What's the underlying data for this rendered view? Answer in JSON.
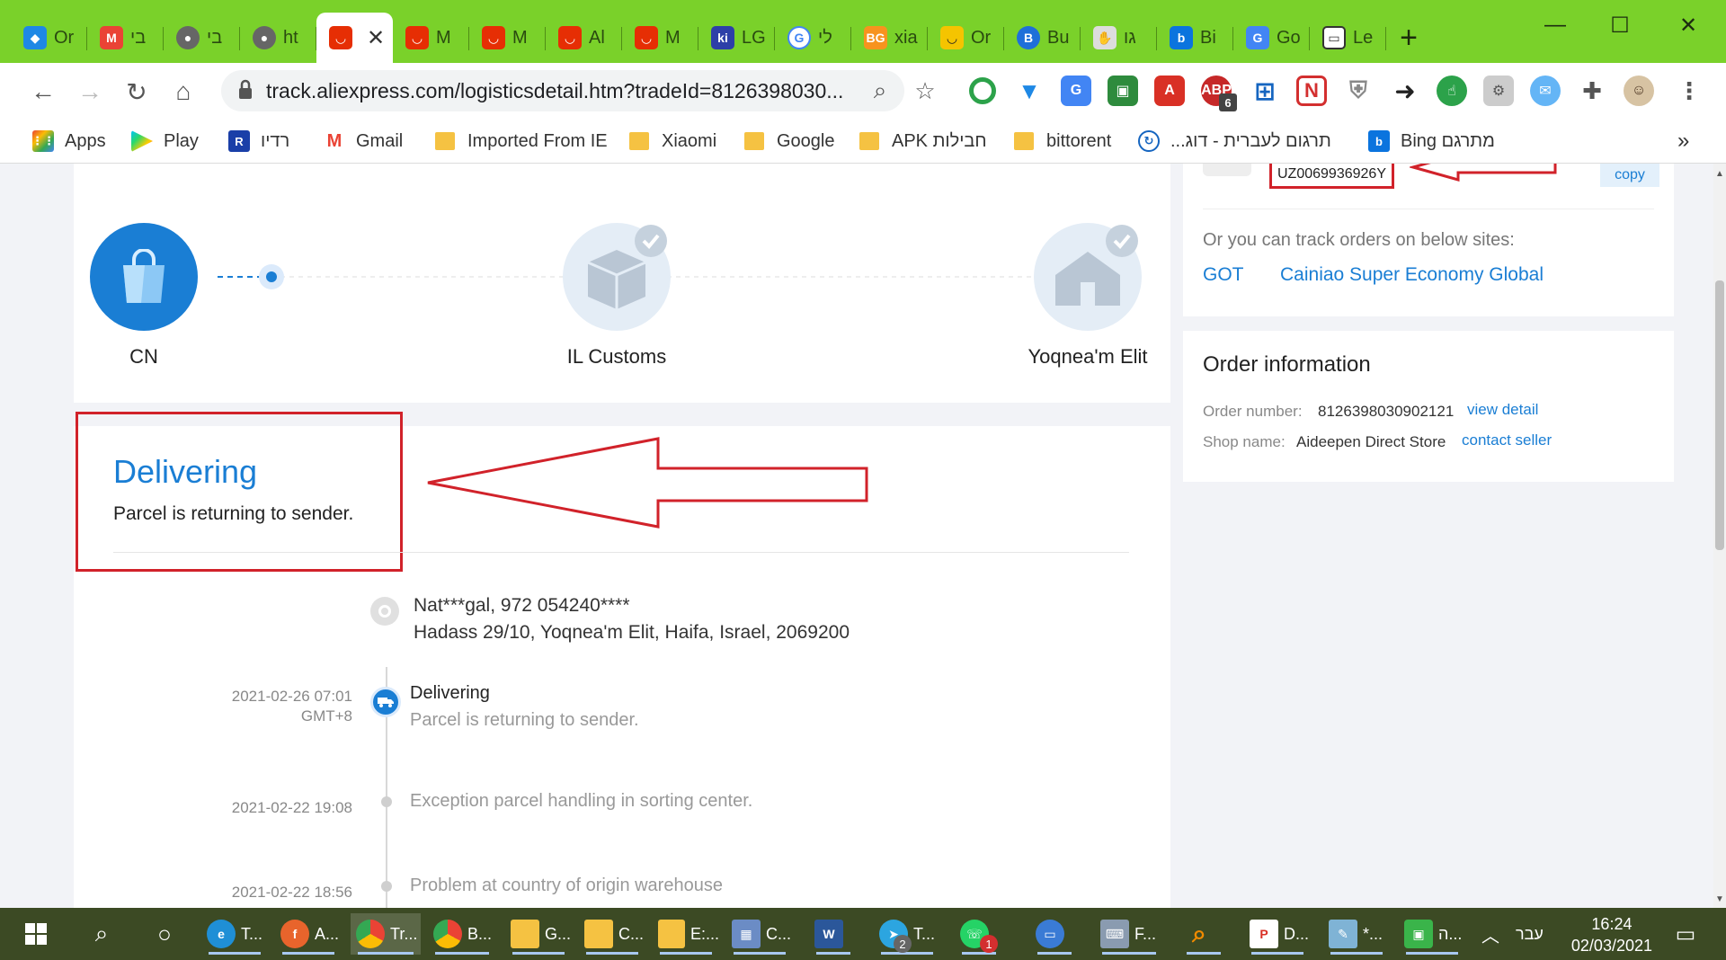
{
  "browser": {
    "tabs": [
      {
        "label": "Or",
        "icon": "diamond-icon",
        "color": "#1e88e5"
      },
      {
        "label": "בי",
        "icon": "gmail-icon",
        "color": "#ea4335"
      },
      {
        "label": "בי",
        "icon": "globe-icon",
        "color": "#666666"
      },
      {
        "label": "ht",
        "icon": "globe-icon",
        "color": "#666666"
      },
      {
        "label": "M",
        "icon": "aliexpress-icon",
        "color": "#e62e04"
      },
      {
        "label": "M",
        "icon": "aliexpress-icon",
        "color": "#e62e04"
      },
      {
        "label": "Al",
        "icon": "aliexpress-icon",
        "color": "#e62e04"
      },
      {
        "label": "M",
        "icon": "aliexpress-icon",
        "color": "#e62e04"
      },
      {
        "label": "LG",
        "icon": "ki-icon",
        "color": "#2d3fa8"
      },
      {
        "label": "לי",
        "icon": "google-icon",
        "color": "#4285f4"
      },
      {
        "label": "xia",
        "icon": "bg-icon",
        "color": "#f7931e"
      },
      {
        "label": "Or",
        "icon": "smile-icon",
        "color": "#f5c400"
      },
      {
        "label": "Bu",
        "icon": "b-icon",
        "color": "#1e6fd9"
      },
      {
        "label": "גו",
        "icon": "hand-icon",
        "color": "#444444"
      },
      {
        "label": "Bi",
        "icon": "bing-icon",
        "color": "#0b74de"
      },
      {
        "label": "Go",
        "icon": "translate-icon",
        "color": "#4285f4"
      },
      {
        "label": "Le",
        "icon": "screen-icon",
        "color": "#333333"
      }
    ],
    "active_tab_close": "✕",
    "new_tab": "+",
    "url": "track.aliexpress.com/logisticsdetail.htm?tradeId=8126398030...",
    "bookmarks": [
      {
        "label": "Apps",
        "type": "apps"
      },
      {
        "label": "Play",
        "type": "play"
      },
      {
        "label": "רדיו",
        "type": "radio"
      },
      {
        "label": "Gmail",
        "type": "gmail"
      },
      {
        "label": "Imported From IE",
        "type": "folder"
      },
      {
        "label": "Xiaomi",
        "type": "folder"
      },
      {
        "label": "Google",
        "type": "folder"
      },
      {
        "label": "APK חבילות",
        "type": "folder"
      },
      {
        "label": "bittorent",
        "type": "folder"
      },
      {
        "label": "תרגום לעברית - דוג...",
        "type": "site"
      },
      {
        "label": "Bing מתרגם",
        "type": "bing"
      }
    ],
    "more": "»",
    "ext_badge": "6"
  },
  "tracking": {
    "steps": [
      {
        "label": "CN",
        "state": "active"
      },
      {
        "label": "IL Customs",
        "state": "pending"
      },
      {
        "label": "Yoqnea'm Elit",
        "state": "pending"
      }
    ],
    "status_title": "Delivering",
    "status_subtitle": "Parcel is returning to sender.",
    "recipient_line1": "Nat***gal,  972 054240****",
    "recipient_line2": "Hadass 29/10,  Yoqnea'm Elit,  Haifa,  Israel,  2069200",
    "events": [
      {
        "date": "2021-02-26 07:01",
        "tz": "GMT+8",
        "title": "Delivering",
        "text": "Parcel is returning to sender."
      },
      {
        "date": "2021-02-22 19:08",
        "tz": "",
        "title": "",
        "text": "Exception parcel handling in sorting center."
      },
      {
        "date": "2021-02-22 18:56",
        "tz": "",
        "title": "",
        "text": "Problem at country of origin warehouse"
      }
    ]
  },
  "right_panel": {
    "tracking_number": "UZ0069936926Y",
    "copy_label": "copy",
    "other_sites_label": "Or you can track orders on below sites:",
    "sites": [
      "GOT",
      "Cainiao Super Economy Global"
    ],
    "order_info_title": "Order information",
    "order_number_label": "Order number:",
    "order_number": "8126398030902121",
    "view_detail": "view detail",
    "shop_name_label": "Shop name:",
    "shop_name": "Aideepen Direct Store",
    "contact_seller": "contact seller"
  },
  "taskbar": {
    "items": [
      {
        "label": "T...",
        "icon": "edge-icon",
        "color": "#1f8fd6"
      },
      {
        "label": "A...",
        "icon": "firefox-icon",
        "color": "#e8642c"
      },
      {
        "label": "Tr...",
        "icon": "chrome-icon",
        "color": "#4285f4"
      },
      {
        "label": "B...",
        "icon": "chrome-icon",
        "color": "#4285f4"
      },
      {
        "label": "G...",
        "icon": "folder-icon",
        "color": "#f5c242"
      },
      {
        "label": "C...",
        "icon": "folder-icon",
        "color": "#f5c242"
      },
      {
        "label": "E:...",
        "icon": "folder-icon",
        "color": "#f5c242"
      },
      {
        "label": "C...",
        "icon": "calculator-icon",
        "color": "#6b8cc5"
      },
      {
        "label": "",
        "icon": "word-icon",
        "color": "#2b579a"
      },
      {
        "label": "T...",
        "icon": "telegram-icon",
        "color": "#2ca5e0"
      },
      {
        "label": "",
        "icon": "whatsapp-icon",
        "color": "#25d366"
      },
      {
        "label": "",
        "icon": "chat-icon",
        "color": "#3a7bd5"
      },
      {
        "label": "F...",
        "icon": "keyboard-icon",
        "color": "#8a9bb0"
      },
      {
        "label": "",
        "icon": "search-tool-icon",
        "color": "#f08a00"
      },
      {
        "label": "D...",
        "icon": "pdf-icon",
        "color": "#d93025"
      },
      {
        "label": "*...",
        "icon": "notepad-icon",
        "color": "#7fb3d5"
      },
      {
        "label": "ה...",
        "icon": "robot-icon",
        "color": "#3ab44a"
      }
    ],
    "telegram_badge": "2",
    "whatsapp_badge": "1",
    "language": "עבר",
    "time": "16:24",
    "date": "02/03/2021"
  }
}
